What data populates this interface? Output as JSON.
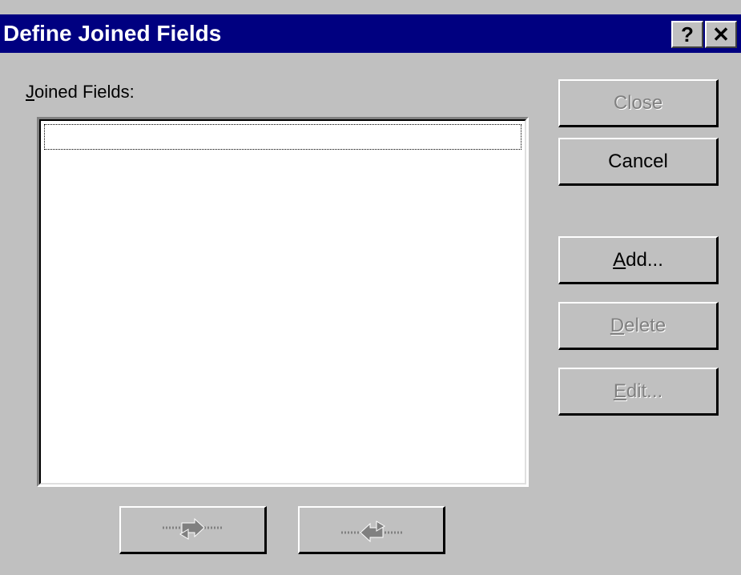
{
  "window": {
    "title": "Define Joined Fields",
    "help_label": "?",
    "close_label": "✕"
  },
  "joined_fields": {
    "label": "oined Fields:",
    "accel": "J",
    "items": []
  },
  "buttons": {
    "close": {
      "label": "Close",
      "enabled": false
    },
    "cancel": {
      "label": "Cancel",
      "enabled": true
    },
    "add": {
      "accel": "A",
      "rest": "dd...",
      "enabled": true
    },
    "delete": {
      "accel": "D",
      "rest": "elete",
      "enabled": false
    },
    "edit": {
      "accel": "E",
      "rest": "dit...",
      "enabled": false
    },
    "move_right": {
      "icon": "arrow-right-icon",
      "enabled": false
    },
    "move_left": {
      "icon": "arrow-left-icon",
      "enabled": false
    }
  },
  "colors": {
    "titlebar": "#000080",
    "face": "#c0c0c0",
    "disabled_text": "#808080"
  }
}
